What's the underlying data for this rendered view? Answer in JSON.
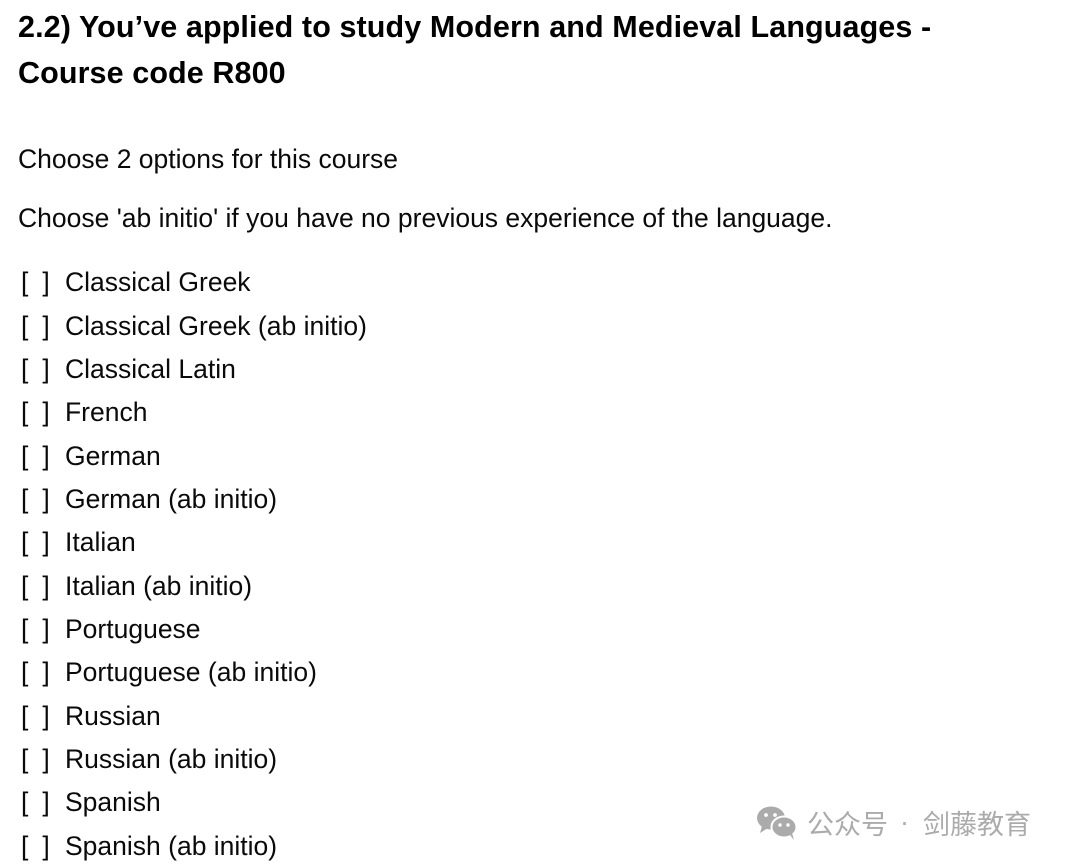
{
  "question": {
    "title_line_1": "2.2) You’ve applied to study Modern and Medieval Languages -",
    "title_line_2": "Course code R800",
    "instruction_1": "Choose 2 options for this course",
    "instruction_2": "Choose 'ab initio' if you have no previous experience of the language."
  },
  "checkbox": {
    "open": "[",
    "close": "]"
  },
  "options": [
    {
      "label": "Classical Greek",
      "checked": false
    },
    {
      "label": "Classical Greek (ab initio)",
      "checked": false
    },
    {
      "label": "Classical Latin",
      "checked": false
    },
    {
      "label": "French",
      "checked": false
    },
    {
      "label": "German",
      "checked": false
    },
    {
      "label": "German (ab initio)",
      "checked": false
    },
    {
      "label": "Italian",
      "checked": false
    },
    {
      "label": "Italian (ab initio)",
      "checked": false
    },
    {
      "label": "Portuguese",
      "checked": false
    },
    {
      "label": "Portuguese (ab initio)",
      "checked": false
    },
    {
      "label": "Russian",
      "checked": false
    },
    {
      "label": "Russian (ab initio)",
      "checked": false
    },
    {
      "label": "Spanish",
      "checked": false
    },
    {
      "label": "Spanish (ab initio)",
      "checked": false
    }
  ],
  "watermark": {
    "icon": "wechat-icon",
    "prefix": "公众号",
    "separator": "·",
    "account": "剑藤教育",
    "color": "#ababab"
  }
}
